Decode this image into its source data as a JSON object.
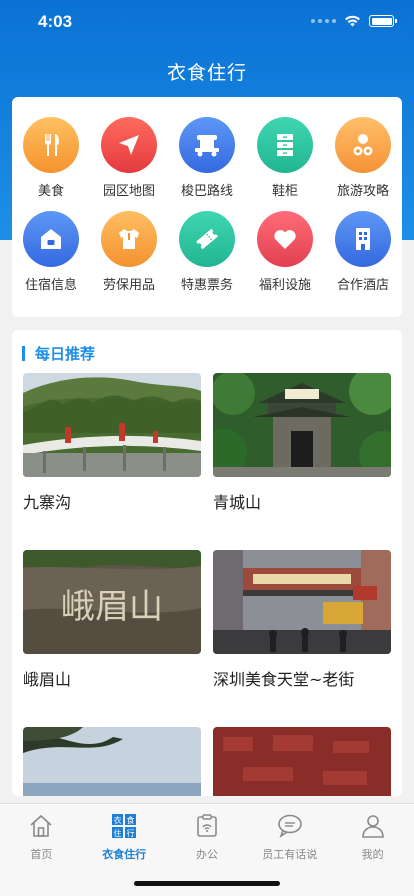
{
  "status": {
    "time": "4:03"
  },
  "nav": {
    "title": "衣食住行"
  },
  "services": [
    {
      "label": "美食",
      "icon": "fork-knife-icon",
      "color": "#f7a53a"
    },
    {
      "label": "园区地图",
      "icon": "navigation-arrow-icon",
      "color": "#ee4a4a"
    },
    {
      "label": "梭巴路线",
      "icon": "shuttle-bus-icon",
      "color": "#3f7fe8"
    },
    {
      "label": "鞋柜",
      "icon": "cabinet-icon",
      "color": "#2fc7a2"
    },
    {
      "label": "旅游攻略",
      "icon": "guide-icon",
      "color": "#f9a54a"
    },
    {
      "label": "住宿信息",
      "icon": "house-icon",
      "color": "#3f7fe8"
    },
    {
      "label": "劳保用品",
      "icon": "shirt-icon",
      "color": "#f8a542"
    },
    {
      "label": "特惠票务",
      "icon": "ticket-icon",
      "color": "#2fc7a2"
    },
    {
      "label": "福利设施",
      "icon": "heart-icon",
      "color": "#ee4f5e"
    },
    {
      "label": "合作酒店",
      "icon": "building-icon",
      "color": "#3f7fe8"
    }
  ],
  "recommend": {
    "title": "每日推荐",
    "items": [
      {
        "name": "九寨沟"
      },
      {
        "name": "青城山"
      },
      {
        "name": "峨眉山"
      },
      {
        "name": "深圳美食天堂~老街"
      }
    ]
  },
  "tabs": [
    {
      "label": "首页",
      "icon": "home-icon",
      "active": false
    },
    {
      "label": "衣食住行",
      "icon": "grid-app-icon",
      "active": true
    },
    {
      "label": "办公",
      "icon": "office-icon",
      "active": false
    },
    {
      "label": "员工有话说",
      "icon": "chat-icon",
      "active": false
    },
    {
      "label": "我的",
      "icon": "person-icon",
      "active": false
    }
  ],
  "image_sign_text": "峨眉山"
}
